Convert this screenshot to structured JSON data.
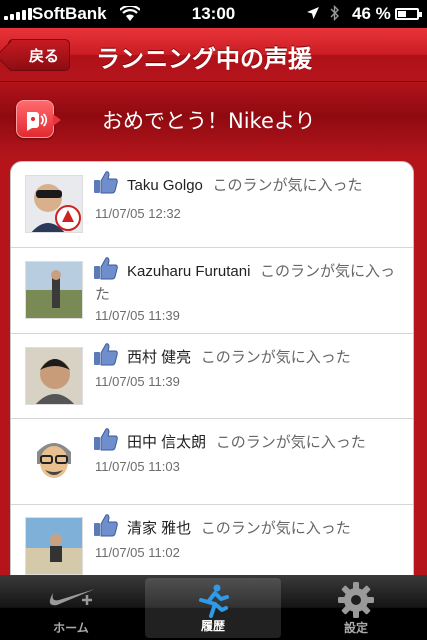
{
  "status_bar": {
    "carrier": "SoftBank",
    "time": "13:00",
    "battery": "46 %",
    "battery_level": 0.46
  },
  "nav": {
    "back_label": "戻る",
    "title": "ランニング中の声援"
  },
  "banner": {
    "text": "おめでとう！Nikeより",
    "icon": "speaker-icon"
  },
  "feed": [
    {
      "name": "Taku Golgo",
      "message": "このランが気に入った",
      "time": "11/07/05 12:32"
    },
    {
      "name": "Kazuharu Furutani",
      "message": "このランが気に入った",
      "time": "11/07/05 11:39"
    },
    {
      "name": "西村 健亮",
      "message": "このランが気に入った",
      "time": "11/07/05 11:39"
    },
    {
      "name": "田中 信太朗",
      "message": "このランが気に入った",
      "time": "11/07/05 11:03"
    },
    {
      "name": "清家 雅也",
      "message": "このランが気に入った",
      "time": "11/07/05 11:02"
    }
  ],
  "tabs": [
    {
      "label": "ホーム",
      "icon": "nike-swoosh-icon",
      "active": false
    },
    {
      "label": "履歴",
      "icon": "runner-icon",
      "active": true
    },
    {
      "label": "設定",
      "icon": "gear-icon",
      "active": false
    }
  ],
  "colors": {
    "nav_red": "#cc1d24",
    "active_tab": "#2f9be8"
  }
}
